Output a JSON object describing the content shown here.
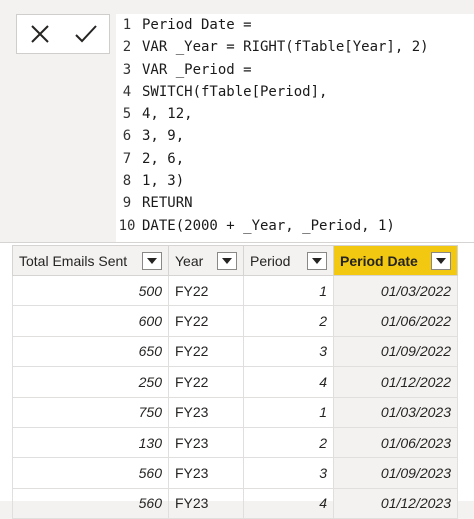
{
  "formula": {
    "lines": [
      {
        "num": "1",
        "text": "Period Date ="
      },
      {
        "num": "2",
        "text": "VAR _Year = RIGHT(fTable[Year], 2)"
      },
      {
        "num": "3",
        "text": "VAR _Period ="
      },
      {
        "num": "4",
        "text": "SWITCH(fTable[Period],"
      },
      {
        "num": "5",
        "text": "4, 12,"
      },
      {
        "num": "6",
        "text": "3, 9,"
      },
      {
        "num": "7",
        "text": "2, 6,"
      },
      {
        "num": "8",
        "text": "1, 3)"
      },
      {
        "num": "9",
        "text": "RETURN"
      },
      {
        "num": "10",
        "text": "DATE(2000 + _Year, _Period, 1)"
      }
    ],
    "cancel_icon": "close-icon",
    "commit_icon": "check-icon"
  },
  "table": {
    "columns": [
      "Total Emails Sent",
      "Year",
      "Period",
      "Period Date"
    ],
    "active_column": "Period Date",
    "active_color": "#f2c811",
    "rows": [
      [
        "500",
        "FY22",
        "1",
        "01/03/2022"
      ],
      [
        "600",
        "FY22",
        "2",
        "01/06/2022"
      ],
      [
        "650",
        "FY22",
        "3",
        "01/09/2022"
      ],
      [
        "250",
        "FY22",
        "4",
        "01/12/2022"
      ],
      [
        "750",
        "FY23",
        "1",
        "01/03/2023"
      ],
      [
        "130",
        "FY23",
        "2",
        "01/06/2023"
      ],
      [
        "560",
        "FY23",
        "3",
        "01/09/2023"
      ],
      [
        "560",
        "FY23",
        "4",
        "01/12/2023"
      ]
    ]
  }
}
